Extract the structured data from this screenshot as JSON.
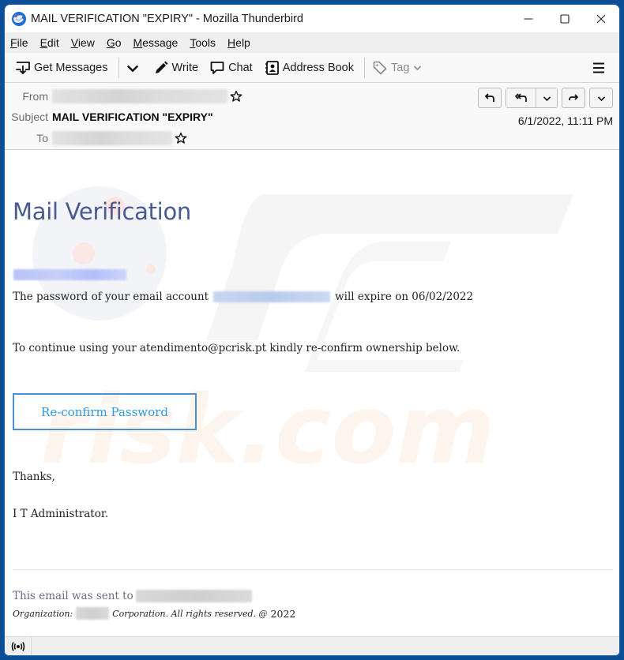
{
  "window": {
    "title": "MAIL VERIFICATION \"EXPIRY\" - Mozilla Thunderbird",
    "app_icon": "thunderbird-logo-icon",
    "controls": [
      "minimize-icon",
      "maximize-icon",
      "close-icon"
    ]
  },
  "menubar": {
    "items": [
      {
        "label": "File",
        "accel": "F",
        "rest": "ile"
      },
      {
        "label": "Edit",
        "accel": "E",
        "rest": "dit"
      },
      {
        "label": "View",
        "accel": "V",
        "rest": "iew"
      },
      {
        "label": "Go",
        "accel": "G",
        "rest": "o"
      },
      {
        "label": "Message",
        "accel": "M",
        "rest": "essage"
      },
      {
        "label": "Tools",
        "accel": "T",
        "rest": "ools"
      },
      {
        "label": "Help",
        "accel": "H",
        "rest": "elp"
      }
    ]
  },
  "toolbar": {
    "get_messages": "Get Messages",
    "write": "Write",
    "chat": "Chat",
    "address_book": "Address Book",
    "tag": "Tag"
  },
  "header": {
    "from_label": "From",
    "from_value_redacted": true,
    "subject_label": "Subject",
    "subject_value": "MAIL VERIFICATION \"EXPIRY\"",
    "to_label": "To",
    "to_value_redacted": true,
    "date": "6/1/2022, 11:11 PM",
    "actions": [
      "reply",
      "reply-all",
      "reply-all-dropdown",
      "forward",
      "more-dropdown"
    ]
  },
  "message": {
    "heading": "Mail Verification",
    "line1_before": "The password of your email account",
    "line1_after": "will expire on 06/02/2022",
    "line2": "To continue using your atendimento@pcrisk.pt kindly re-confirm ownership below.",
    "button_label": "Re-confirm Password",
    "thanks": "Thanks,",
    "signature": "I T Administrator.",
    "footer_sent_to": "This email was sent to",
    "footer_org_label": "Organization:",
    "footer_org_rest": "Corporation. All rights reserved. @",
    "footer_year": "2022",
    "link_color": "#2e9be0",
    "heading_color": "#4a5a8f"
  },
  "watermark": {
    "text_top": "PC",
    "text_bottom": "risk.com"
  },
  "statusbar": {
    "icon": "online-status-icon"
  }
}
